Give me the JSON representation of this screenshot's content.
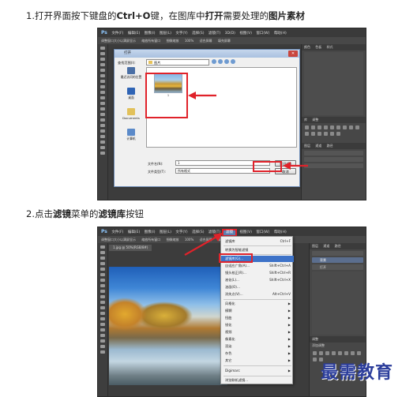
{
  "steps": {
    "step1": {
      "prefix": "1.打开界面按下键盘的",
      "shortcut": "Ctrl+O",
      "middle": "键，在图库中",
      "action": "打开",
      "middle2": "需要处理的",
      "object": "图片素材"
    },
    "step2": {
      "prefix": "2.点击",
      "menu": "滤镜",
      "middle": "菜单的",
      "item": "滤镜库",
      "suffix": "按钮"
    }
  },
  "screenshot1": {
    "logo": "Ps",
    "menu": [
      "文件(F)",
      "编辑(E)",
      "图像(I)",
      "图层(L)",
      "文字(Y)",
      "选择(S)",
      "滤镜(T)",
      "3D(D)",
      "视图(V)",
      "窗口(W)",
      "帮助(H)"
    ],
    "options": [
      "调整窗口大小以满屏显示",
      "缩放所有窗口",
      "细微缩放",
      "100%",
      "适合屏幕",
      "填充屏幕"
    ],
    "panel_tabs": [
      "颜色",
      "色板",
      "样式"
    ],
    "panel_tabs2": [
      "库",
      "调整"
    ],
    "panel_tabs3": [
      "图层",
      "通道",
      "路径"
    ],
    "dialog": {
      "title": "打开",
      "look_in_label": "查找范围(I):",
      "look_in_value": "图片",
      "sidebar": [
        "最近访问的位置",
        "桌面",
        "Documents",
        "计算机"
      ],
      "file_name_label": "文件名(N):",
      "file_name_value": "1",
      "file_type_label": "文件类型(T):",
      "file_type_value": "所有格式",
      "open_button": "打开(O)",
      "cancel_button": "取消",
      "thumb_label": "1"
    }
  },
  "screenshot2": {
    "logo": "Ps",
    "menu": [
      "文件(F)",
      "编辑(E)",
      "图像(I)",
      "图层(L)",
      "文字(Y)",
      "选择(S)",
      "滤镜(T)",
      "3D(D)",
      "视图(V)",
      "窗口(W)",
      "帮助(H)"
    ],
    "options": [
      "调整窗口大小以满屏显示",
      "缩放所有窗口",
      "细微缩放",
      "100%",
      "适合屏幕",
      "填充屏幕"
    ],
    "doc_tab": "1.jpg @ 50%(RGB/8#)",
    "highlighted_menu": "滤镜",
    "panel_tabs": [
      "图层",
      "通道",
      "路径"
    ],
    "layer_name": "背景",
    "layer2": "打开",
    "panel_tabs2": [
      "调整"
    ],
    "panel_tabs3": [
      "添加调整"
    ],
    "dropdown": [
      {
        "label": "滤镜库",
        "shortcut": "Ctrl+F"
      },
      {
        "label": "转换为智能滤镜",
        "shortcut": ""
      },
      {
        "label": "滤镜库(G)...",
        "shortcut": "",
        "highlight": true
      },
      {
        "label": "自适应广角(A)...",
        "shortcut": "Shift+Ctrl+A"
      },
      {
        "label": "镜头校正(R)...",
        "shortcut": "Shift+Ctrl+R"
      },
      {
        "label": "液化(L)...",
        "shortcut": "Shift+Ctrl+X"
      },
      {
        "label": "油画(O)...",
        "shortcut": ""
      },
      {
        "label": "消失点(V)...",
        "shortcut": "Alt+Ctrl+V"
      },
      {
        "label": "风格化",
        "shortcut": "",
        "sub": true
      },
      {
        "label": "模糊",
        "shortcut": "",
        "sub": true
      },
      {
        "label": "扭曲",
        "shortcut": "",
        "sub": true
      },
      {
        "label": "锐化",
        "shortcut": "",
        "sub": true
      },
      {
        "label": "视频",
        "shortcut": "",
        "sub": true
      },
      {
        "label": "像素化",
        "shortcut": "",
        "sub": true
      },
      {
        "label": "渲染",
        "shortcut": "",
        "sub": true
      },
      {
        "label": "杂色",
        "shortcut": "",
        "sub": true
      },
      {
        "label": "其它",
        "shortcut": "",
        "sub": true
      },
      {
        "label": "Digimarc",
        "shortcut": "",
        "sub": true
      },
      {
        "label": "浏览联机滤镜...",
        "shortcut": ""
      }
    ]
  },
  "watermark": "最需教育",
  "colors": {
    "highlight_red": "#e0222a",
    "menu_blue": "#3d72c8",
    "watermark": "#2b3d9b"
  }
}
